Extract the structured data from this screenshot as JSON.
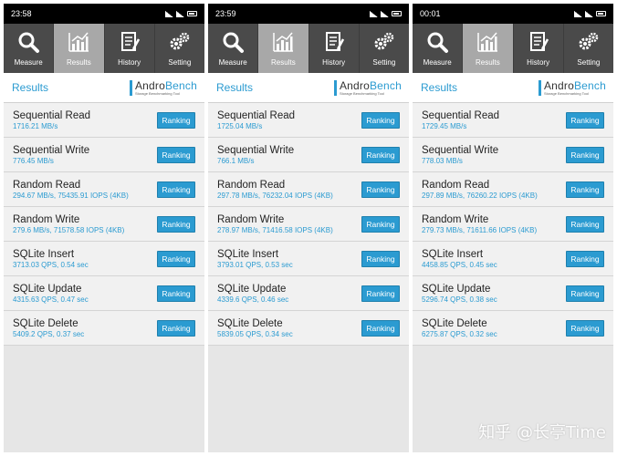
{
  "nav_labels": [
    "Measure",
    "Results",
    "History",
    "Setting"
  ],
  "nav_icons": [
    "magnifier-icon",
    "chart-icon",
    "document-icon",
    "gears-icon"
  ],
  "header_title": "Results",
  "logo": {
    "prefix": "Andro",
    "accent": "Bench",
    "tagline": "Storage Benchmarking Tool"
  },
  "ranking_label": "Ranking",
  "accent_color": "#2b9bd1",
  "watermark": "知乎 @长亭Time",
  "screens": [
    {
      "status_time": "23:58",
      "rows": [
        {
          "title": "Sequential Read",
          "value": "1716.21 MB/s"
        },
        {
          "title": "Sequential Write",
          "value": "776.45 MB/s"
        },
        {
          "title": "Random Read",
          "value": "294.67 MB/s, 75435.91 IOPS (4KB)"
        },
        {
          "title": "Random Write",
          "value": "279.6 MB/s, 71578.58 IOPS (4KB)"
        },
        {
          "title": "SQLite Insert",
          "value": "3713.03 QPS, 0.54 sec"
        },
        {
          "title": "SQLite Update",
          "value": "4315.63 QPS, 0.47 sec"
        },
        {
          "title": "SQLite Delete",
          "value": "5409.2 QPS, 0.37 sec"
        }
      ]
    },
    {
      "status_time": "23:59",
      "rows": [
        {
          "title": "Sequential Read",
          "value": "1725.04 MB/s"
        },
        {
          "title": "Sequential Write",
          "value": "766.1 MB/s"
        },
        {
          "title": "Random Read",
          "value": "297.78 MB/s, 76232.04 IOPS (4KB)"
        },
        {
          "title": "Random Write",
          "value": "278.97 MB/s, 71416.58 IOPS (4KB)"
        },
        {
          "title": "SQLite Insert",
          "value": "3793.01 QPS, 0.53 sec"
        },
        {
          "title": "SQLite Update",
          "value": "4339.6 QPS, 0.46 sec"
        },
        {
          "title": "SQLite Delete",
          "value": "5839.05 QPS, 0.34 sec"
        }
      ]
    },
    {
      "status_time": "00:01",
      "rows": [
        {
          "title": "Sequential Read",
          "value": "1729.45 MB/s"
        },
        {
          "title": "Sequential Write",
          "value": "778.03 MB/s"
        },
        {
          "title": "Random Read",
          "value": "297.89 MB/s, 76260.22 IOPS (4KB)"
        },
        {
          "title": "Random Write",
          "value": "279.73 MB/s, 71611.66 IOPS (4KB)"
        },
        {
          "title": "SQLite Insert",
          "value": "4458.85 QPS, 0.45 sec"
        },
        {
          "title": "SQLite Update",
          "value": "5296.74 QPS, 0.38 sec"
        },
        {
          "title": "SQLite Delete",
          "value": "6275.87 QPS, 0.32 sec"
        }
      ]
    }
  ]
}
